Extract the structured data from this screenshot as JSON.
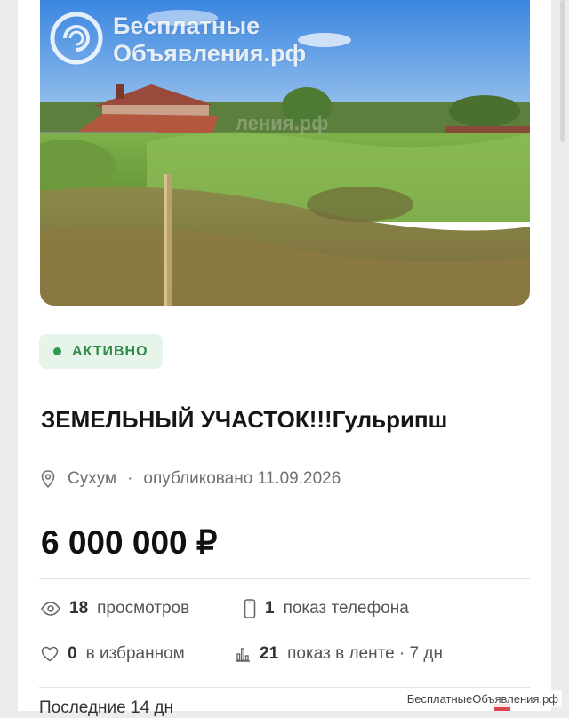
{
  "watermark": {
    "line1": "Бесплатные",
    "line2": "Объявления.рф"
  },
  "listing": {
    "status": "АКТИВНО",
    "title": "ЗЕМЕЛЬНЫЙ УЧАСТОК!!!Гульрипш",
    "location": "Сухум",
    "separator": "·",
    "published": "опубликовано 11.09.2026",
    "price": "6 000 000 ₽"
  },
  "stats": {
    "views_count": "18",
    "views_label": "просмотров",
    "phone_count": "1",
    "phone_label": "показ телефона",
    "favorites_count": "0",
    "favorites_label": "в избранном",
    "feed_count": "21",
    "feed_label": "показ в ленте · 7 дн"
  },
  "bottom_text": "Последние 14 дн",
  "footer_watermark": "БесплатныеОбъявления.рф",
  "colors": {
    "status_green": "#2e8a48",
    "status_bg": "#e6f4ea"
  }
}
